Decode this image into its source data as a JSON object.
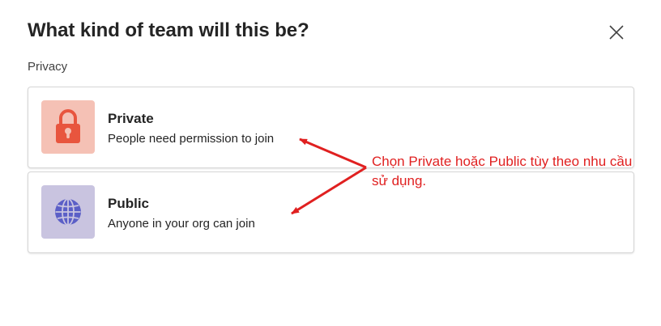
{
  "dialog": {
    "title": "What kind of team will this be?",
    "privacy_label": "Privacy",
    "close_icon": "close-icon"
  },
  "options": [
    {
      "title": "Private",
      "description": "People need permission to join",
      "icon": "lock-icon",
      "icon_bg": "#f5c1b5",
      "icon_color": "#e8553e"
    },
    {
      "title": "Public",
      "description": "Anyone in your org can join",
      "icon": "globe-icon",
      "icon_bg": "#c9c4e0",
      "icon_color": "#5b5fc7"
    }
  ],
  "annotation": {
    "text": "Chọn Private hoặc Public tùy theo nhu cầu sử dụng.",
    "color": "#e02020"
  }
}
